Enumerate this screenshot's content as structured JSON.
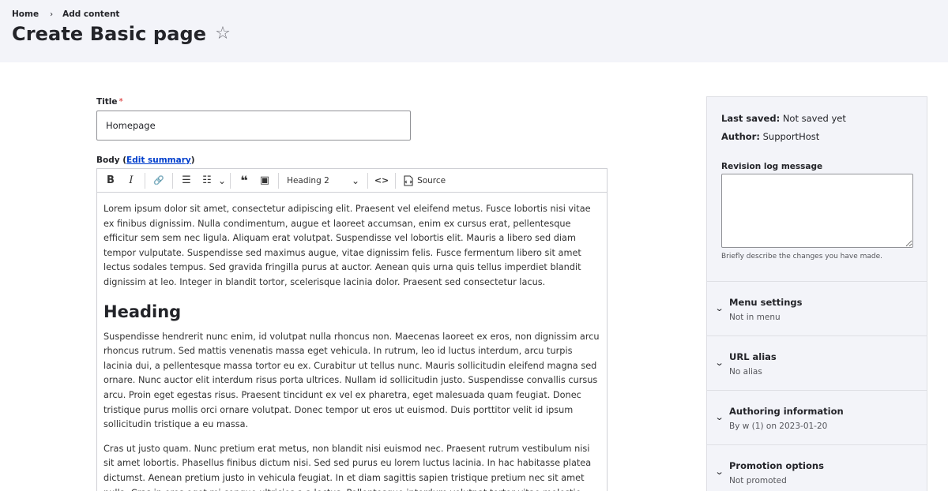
{
  "breadcrumb": {
    "home": "Home",
    "separator": "›",
    "current": "Add content"
  },
  "page": {
    "title": "Create Basic page",
    "star": "☆"
  },
  "form": {
    "title_label": "Title",
    "required_mark": "*",
    "title_value": "Homepage",
    "body_label_prefix": "Body (",
    "body_label_link": "Edit summary",
    "body_label_suffix": ")"
  },
  "toolbar": {
    "bold": "B",
    "italic": "I",
    "link_icon": "🔗",
    "bullet_icon": "☰",
    "numbered_icon": "☷",
    "dropdown_arrow": "⌄",
    "quote_icon": "❝",
    "image_icon": "▣",
    "heading_value": "Heading 2",
    "code_icon": "<>",
    "source_label": "Source"
  },
  "content": {
    "p1": "Lorem ipsum dolor sit amet, consectetur adipiscing elit. Praesent vel eleifend metus. Fusce lobortis nisi vitae ex finibus dignissim. Nulla condimentum, augue et laoreet accumsan, enim ex cursus erat, pellentesque efficitur sem sem nec ligula. Aliquam erat volutpat. Suspendisse vel lobortis elit. Mauris a libero sed diam tempor vulputate. Suspendisse sed maximus augue, vitae dignissim felis. Fusce fermentum libero sit amet lectus sodales tempus. Sed gravida fringilla purus at auctor. Aenean quis urna quis tellus imperdiet blandit dignissim at leo. Integer in blandit tortor, scelerisque lacinia dolor. Praesent sed consectetur lacus.",
    "heading": "Heading",
    "p2": "Suspendisse hendrerit nunc enim, id volutpat nulla rhoncus non. Maecenas laoreet ex eros, non dignissim arcu rhoncus rutrum. Sed mattis venenatis massa eget vehicula. In rutrum, leo id luctus interdum, arcu turpis lacinia dui, a pellentesque massa tortor eu ex. Curabitur ut tellus nunc. Mauris sollicitudin eleifend magna sed ornare. Nunc auctor elit interdum risus porta ultrices. Nullam id sollicitudin justo. Suspendisse convallis cursus arcu. Proin eget egestas risus. Praesent tincidunt ex vel ex pharetra, eget malesuada quam feugiat. Donec tristique purus mollis orci ornare volutpat. Donec tempor ut eros ut euismod. Duis porttitor velit id ipsum sollicitudin tristique a eu massa.",
    "p3": "Cras ut justo quam. Nunc pretium erat metus, non blandit nisi euismod nec. Praesent rutrum vestibulum nisi sit amet lobortis. Phasellus finibus dictum nisi. Sed sed purus eu lorem luctus lacinia. In hac habitasse platea dictumst. Aenean pretium justo in vehicula feugiat. In et diam sagittis sapien tristique pretium nec sit amet nulla. Cras in eros eget mi congue ultricies a a lectus. Pellentesque interdum volutpat tortor vitae molestie. Duis pulvinar viverra urna, efficitur mattis augue dictum non."
  },
  "sidebar": {
    "last_saved_label": "Last saved:",
    "last_saved_value": "Not saved yet",
    "author_label": "Author:",
    "author_value": "SupportHost",
    "revision_label": "Revision log message",
    "revision_value": "",
    "revision_description": "Briefly describe the changes you have made.",
    "chevron": "⌄",
    "sections": [
      {
        "title": "Menu settings",
        "summary": "Not in menu"
      },
      {
        "title": "URL alias",
        "summary": "No alias"
      },
      {
        "title": "Authoring information",
        "summary": "By w (1) on 2023-01-20"
      },
      {
        "title": "Promotion options",
        "summary": "Not promoted"
      }
    ]
  }
}
